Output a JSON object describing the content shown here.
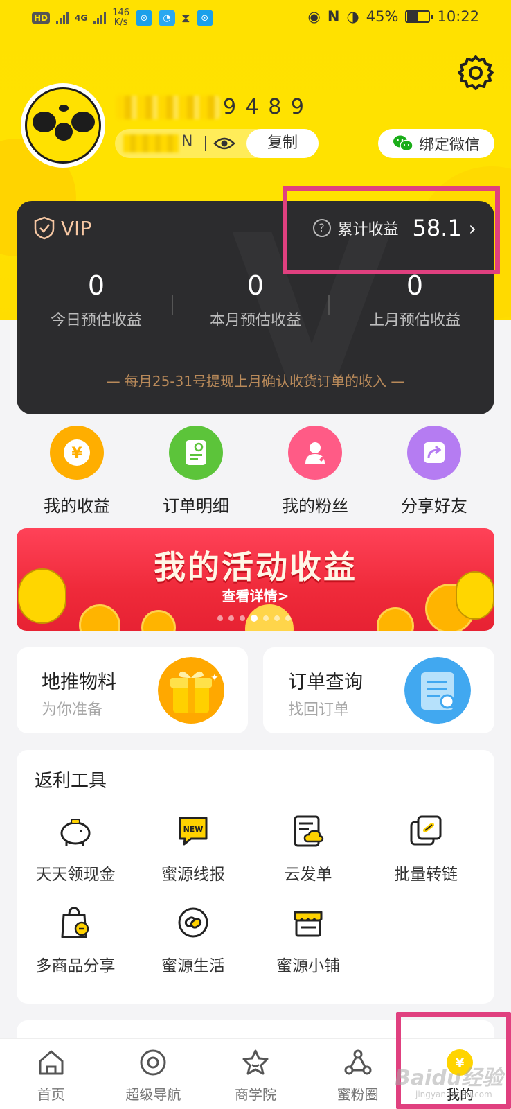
{
  "status_bar": {
    "hd": "HD",
    "network": "4G",
    "speed_value": "146",
    "speed_unit": "K/s",
    "battery": "45%",
    "time": "10:22"
  },
  "profile": {
    "name_suffix": "9 4 8 9",
    "id_suffix": "N",
    "copy_label": "复制",
    "wechat_label": "绑定微信"
  },
  "vip": {
    "badge": "VIP",
    "watermark": "V",
    "total_label": "累计收益",
    "total_value": "58.1",
    "stats": [
      {
        "value": "0",
        "label": "今日预估收益"
      },
      {
        "value": "0",
        "label": "本月预估收益"
      },
      {
        "value": "0",
        "label": "上月预估收益"
      }
    ],
    "note": "— 每月25-31号提现上月确认收货订单的收入 —"
  },
  "quick_menu": [
    {
      "label": "我的收益",
      "icon": "yuan-coin-icon",
      "color": "#ffae00"
    },
    {
      "label": "订单明细",
      "icon": "order-detail-icon",
      "color": "#5cc43a"
    },
    {
      "label": "我的粉丝",
      "icon": "fans-icon",
      "color": "#ff5b86"
    },
    {
      "label": "分享好友",
      "icon": "share-icon",
      "color": "#b57cf2"
    }
  ],
  "banner": {
    "title": "我的活动收益",
    "subtitle": "查看详情>",
    "slide_count": 7,
    "active_slide": 3
  },
  "cards": [
    {
      "title": "地推物料",
      "subtitle": "为你准备",
      "icon": "gift-icon"
    },
    {
      "title": "订单查询",
      "subtitle": "找回订单",
      "icon": "order-search-icon"
    }
  ],
  "rebate_tools": {
    "heading": "返利工具",
    "items": [
      {
        "label": "天天领现金",
        "icon": "piggy-bank-icon"
      },
      {
        "label": "蜜源线报",
        "icon": "new-message-icon"
      },
      {
        "label": "云发单",
        "icon": "cloud-document-icon"
      },
      {
        "label": "批量转链",
        "icon": "batch-link-icon"
      },
      {
        "label": "多商品分享",
        "icon": "shopping-bag-icon"
      },
      {
        "label": "蜜源生活",
        "icon": "link-circle-icon"
      },
      {
        "label": "蜜源小铺",
        "icon": "shop-icon"
      }
    ]
  },
  "bottom_nav": [
    {
      "label": "首页",
      "icon": "home-icon"
    },
    {
      "label": "超级导航",
      "icon": "compass-icon"
    },
    {
      "label": "商学院",
      "icon": "star-icon"
    },
    {
      "label": "蜜粉圈",
      "icon": "network-icon"
    },
    {
      "label": "我的",
      "icon": "profile-icon",
      "active": true
    }
  ],
  "watermark": {
    "text": "Baidu经验",
    "sub": "jingyan.baidu.com"
  },
  "colors": {
    "brand_yellow": "#ffe100",
    "card_dark": "#2c2c2e",
    "highlight_pink": "#e0407f",
    "vip_gold": "#f6c7a3"
  }
}
